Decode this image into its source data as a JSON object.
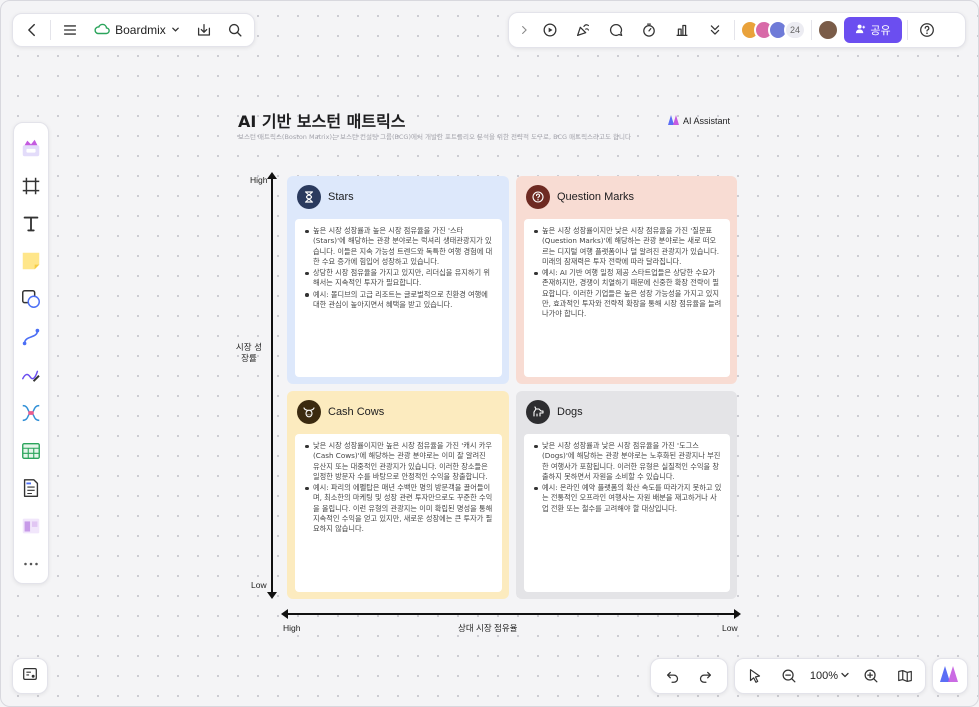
{
  "app": {
    "board_name": "Boardmix"
  },
  "header_right": {
    "collaborator_count": "24",
    "share_label": "공유"
  },
  "board": {
    "title": "AI 기반 보스턴 매트릭스",
    "subtitle": "보스턴 매트릭스(Boston Matrix)는 보스턴 컨설팅 그룹(BCG)에서 개발한 포트폴리오 분석을 위한 전략적 도구로, BCG 매트릭스라고도 합니다",
    "ai_tag": "AI Assistant",
    "y_axis": {
      "label": "시장 성장률",
      "high": "High",
      "low": "Low"
    },
    "x_axis": {
      "label": "상대 시장 점유율",
      "high": "High",
      "low": "Low"
    },
    "quadrants": [
      {
        "title": "Stars",
        "icon": "hourglass-icon",
        "bullets": [
          "높은 시장 성장률과 높은 시장 점유율을 가진 '스타(Stars)'에 해당하는 관광 분야로는 럭셔리 생태관광지가 있습니다. 이들은 지속 가능성 트렌드와 독특한 여행 경험에 대한 수요 증가에 힘입어 성장하고 있습니다.",
          "상당한 시장 점유율을 가지고 있지만, 리더십을 유지하기 위해서는 지속적인 투자가 필요합니다.",
          "예시: 몰디브의 고급 리조트는 글로벌적으로 친환경 여행에 대한 관심이 높아지면서 혜택을 받고 있습니다."
        ]
      },
      {
        "title": "Question Marks",
        "icon": "question-icon",
        "bullets": [
          "높은 시장 성장률이지만 낮은 시장 점유율을 가진 '질문표(Question Marks)'에 해당하는 관광 분야로는 새로 떠오르는 디지털 여행 플랫폼이나 덜 알려진 관광지가 있습니다. 미래의 잠재력은 투자 전략에 따라 달라집니다.",
          "예시: AI 기반 여행 일정 제공 스타트업들은 상당한 수요가 존재하지만, 경쟁이 치열하기 때문에 신중한 확장 전략이 필요합니다. 이러한 기업들은 높은 성장 가능성을 가지고 있지만, 효과적인 투자와 전략적 확장을 통해 시장 점유율을 늘려나가야 합니다."
        ]
      },
      {
        "title": "Cash Cows",
        "icon": "cow-icon",
        "bullets": [
          "낮은 시장 성장률이지만 높은 시장 점유율을 가진 '캐시 카우(Cash Cows)'에 해당하는 관광 분야로는 이미 잘 알려진 유산지 또는 대중적인 관광지가 있습니다. 이러한 장소들은 일정한 방문자 수를 바탕으로 안정적인 수익을 창출합니다.",
          "예시: 파리의 에펠탑은 매년 수백만 명의 방문객을 끌어들이며, 최소한의 마케팅 및 성장 관련 투자만으로도 꾸준한 수익을 올립니다. 이런 유형의 관광지는 이미 확립된 명성을 통해 지속적인 수익을 얻고 있지만, 새로운 성장에는 큰 투자가 필요하지 않습니다."
        ]
      },
      {
        "title": "Dogs",
        "icon": "dog-icon",
        "bullets": [
          "낮은 시장 성장률과 낮은 시장 점유율을 가진 '도그스(Dogs)'에 해당하는 관광 분야로는 노후화된 관광지나 부진한 여행사가 포함됩니다. 이러한 유형은 실질적인 수익을 창출하지 못하면서 자원을 소비할 수 있습니다.",
          "예시: 온라인 예약 플랫폼의 확산 속도를 따라가지 못하고 있는 전통적인 오프라인 여행사는 자원 배분을 재고하거나 사업 전환 또는 철수를 고려해야 할 대상입니다."
        ]
      }
    ]
  },
  "zoom": {
    "value": "100%"
  },
  "colors": {
    "accent": "#6b4ef0",
    "stars_bg": "#dde8fb",
    "question_bg": "#f8dcd3",
    "cows_bg": "#fcebbf",
    "dogs_bg": "#e4e4e7"
  }
}
